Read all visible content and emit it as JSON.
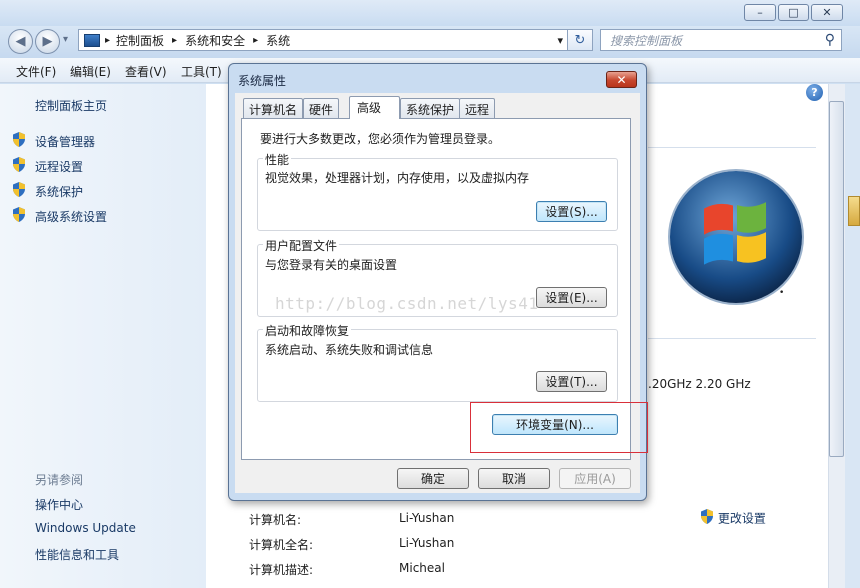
{
  "window": {
    "min": "–",
    "max": "□",
    "close": "✕"
  },
  "nav": {
    "back": "◀",
    "forward": "▶",
    "dropdown": "▾"
  },
  "address": {
    "crumbs": [
      "控制面板",
      "系统和安全",
      "系统"
    ],
    "sep": "▸",
    "drop": "▾",
    "refresh": "↻"
  },
  "search": {
    "placeholder": "搜索控制面板",
    "icon": "⚲"
  },
  "menu": [
    "文件(F)",
    "编辑(E)",
    "查看(V)",
    "工具(T)"
  ],
  "left": {
    "home": "控制面板主页",
    "items": [
      "设备管理器",
      "远程设置",
      "系统保护",
      "高级系统设置"
    ],
    "see_also": "另请参阅",
    "see_items": [
      "操作中心",
      "Windows Update",
      "性能信息和工具"
    ]
  },
  "help_icon": "?",
  "dialog": {
    "title": "系统属性",
    "close": "✕",
    "tabs": [
      "计算机名",
      "硬件",
      "高级",
      "系统保护",
      "远程"
    ],
    "admin_note": "要进行大多数更改，您必须作为管理员登录。",
    "groups": [
      {
        "title": "性能",
        "desc": "视觉效果，处理器计划，内存使用，以及虚拟内存",
        "button": "设置(S)..."
      },
      {
        "title": "用户配置文件",
        "desc": "与您登录有关的桌面设置",
        "button": "设置(E)..."
      },
      {
        "title": "启动和故障恢复",
        "desc": "系统启动、系统失败和调试信息",
        "button": "设置(T)..."
      }
    ],
    "env_button": "环境变量(N)...",
    "ok": "确定",
    "cancel": "取消",
    "apply": "应用(A)"
  },
  "watermark": "http://blog.csdn.net/lys41",
  "cpu_text": ".20GHz   2.20 GHz",
  "computer": {
    "rows": [
      {
        "label": "计算机名:",
        "value": "Li-Yushan"
      },
      {
        "label": "计算机全名:",
        "value": "Li-Yushan"
      },
      {
        "label": "计算机描述:",
        "value": "Micheal"
      }
    ],
    "change": "更改设置"
  },
  "colors": {
    "accent": "#1a3a66",
    "highlight_box": "#d9303a",
    "close_red": "#c7472e"
  }
}
